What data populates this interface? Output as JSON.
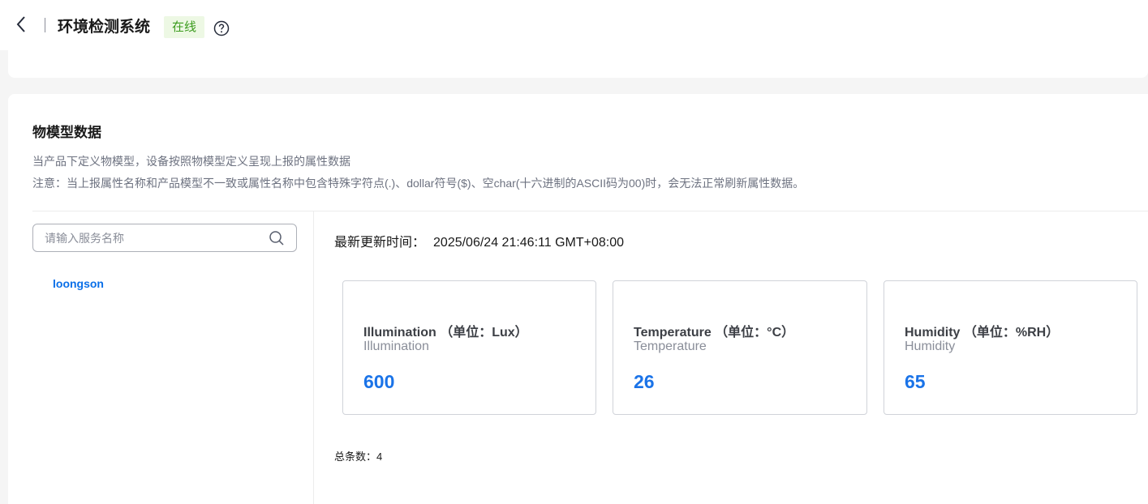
{
  "header": {
    "title": "环境检测系统",
    "status": "在线"
  },
  "section": {
    "title": "物模型数据",
    "desc1": "当产品下定义物模型，设备按照物模型定义呈现上报的属性数据",
    "desc2": "注意：当上报属性名称和产品模型不一致或属性名称中包含特殊字符点(.)、dollar符号($)、空char(十六进制的ASCII码为00)时，会无法正常刷新属性数据。"
  },
  "search": {
    "placeholder": "请输入服务名称"
  },
  "services": [
    {
      "label": "loongson"
    }
  ],
  "update": {
    "label": "最新更新时间：",
    "value": "2025/06/24 21:46:11 GMT+08:00"
  },
  "properties": [
    {
      "name": "Illumination （单位：Lux）",
      "id": "Illumination",
      "value": "600"
    },
    {
      "name": "Temperature （单位：°C）",
      "id": "Temperature",
      "value": "26"
    },
    {
      "name": "Humidity （单位：%RH）",
      "id": "Humidity",
      "value": "65"
    }
  ],
  "total": {
    "label": "总条数：",
    "value": "4"
  },
  "colors": {
    "accent": "#1a73e8",
    "status_bg": "#edf8e4",
    "status_text": "#3b9b1d"
  }
}
